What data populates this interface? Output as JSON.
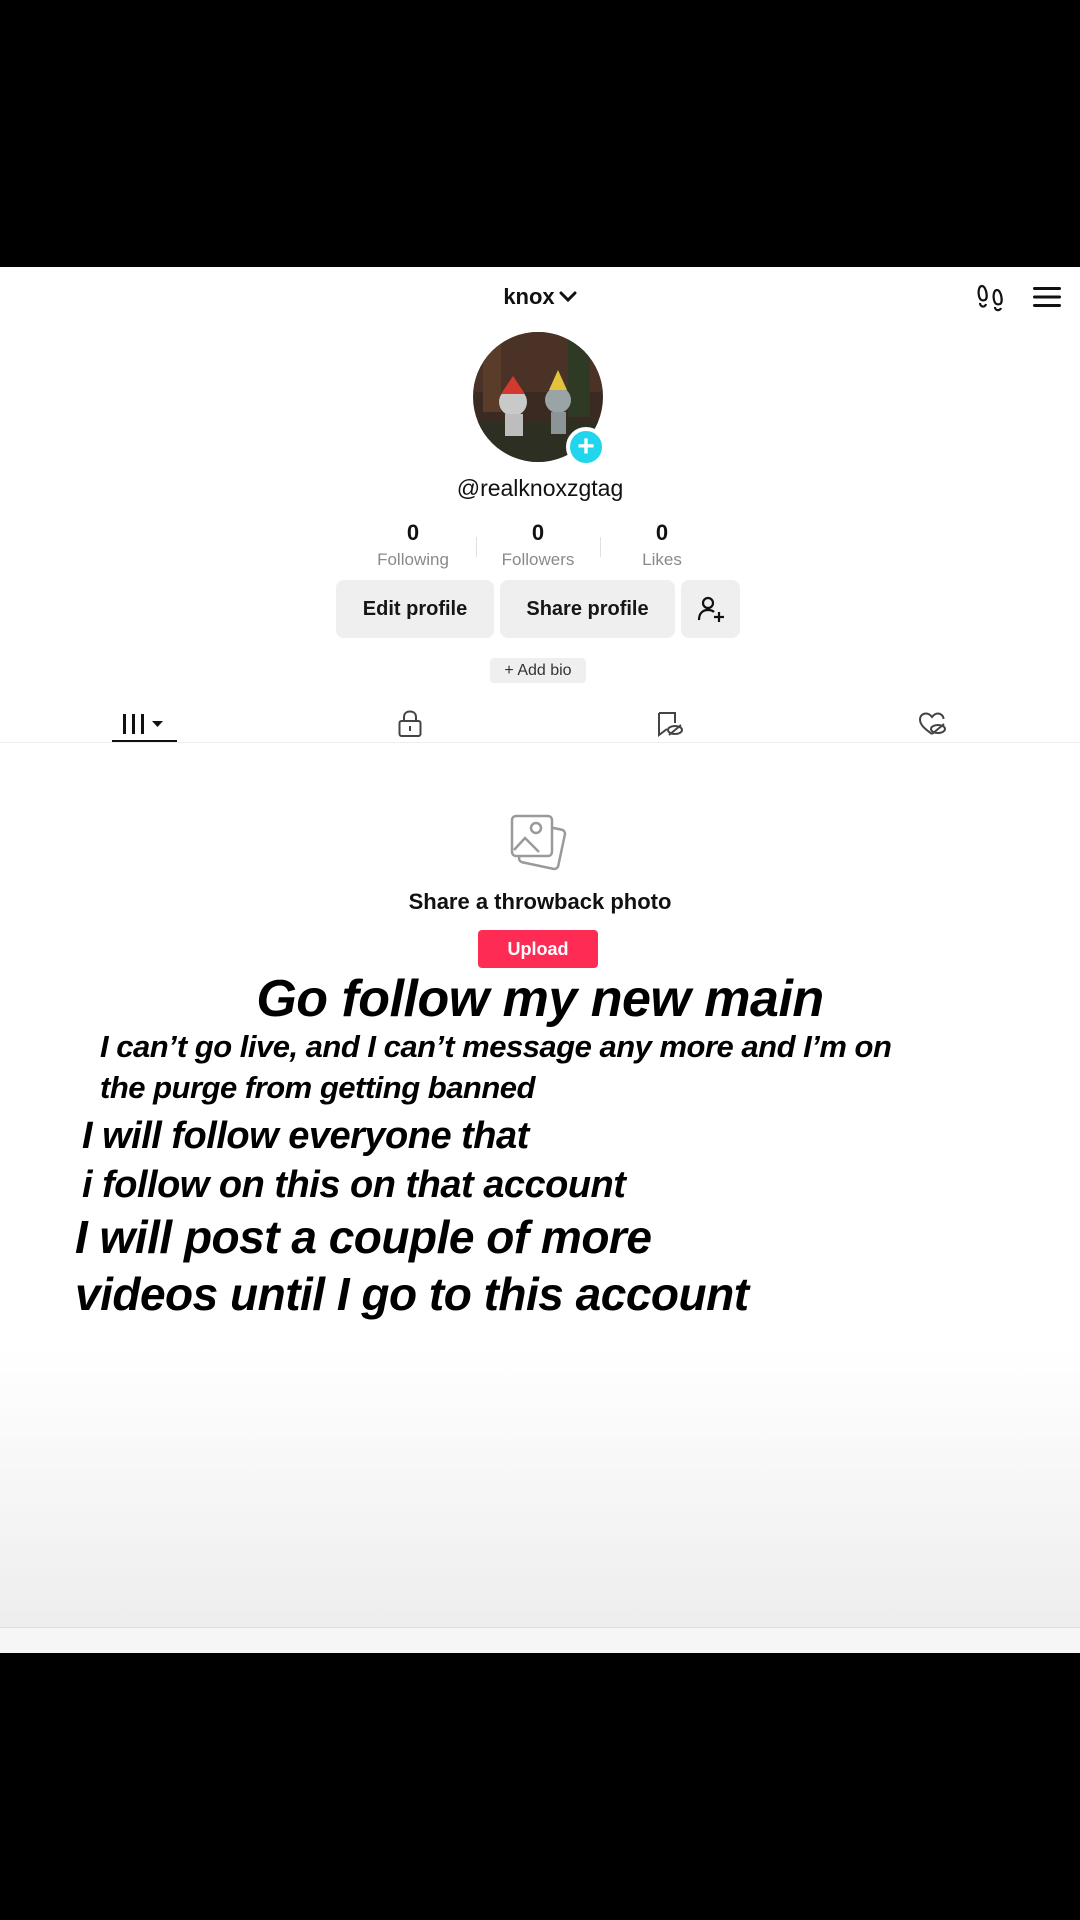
{
  "header": {
    "account_name": "knox"
  },
  "profile": {
    "username": "@realknoxzgtag",
    "stats": [
      {
        "value": "0",
        "label": "Following"
      },
      {
        "value": "0",
        "label": "Followers"
      },
      {
        "value": "0",
        "label": "Likes"
      }
    ],
    "edit_label": "Edit profile",
    "share_label": "Share profile",
    "add_bio": "+ Add bio"
  },
  "empty_state": {
    "title": "Share a throwback photo",
    "upload_label": "Upload"
  },
  "overlay": {
    "main": "Go follow my new main",
    "line1": "I can’t go live, and I can’t message any more and I’m on",
    "line2": "the purge from getting banned",
    "line3": "I will follow everyone that",
    "line4": "i follow on this on that account",
    "line5": "I will post a couple of more",
    "line6": "videos until I go to this account"
  },
  "colors": {
    "accent": "#fe2c55",
    "avatar_badge": "#20d5ec"
  }
}
